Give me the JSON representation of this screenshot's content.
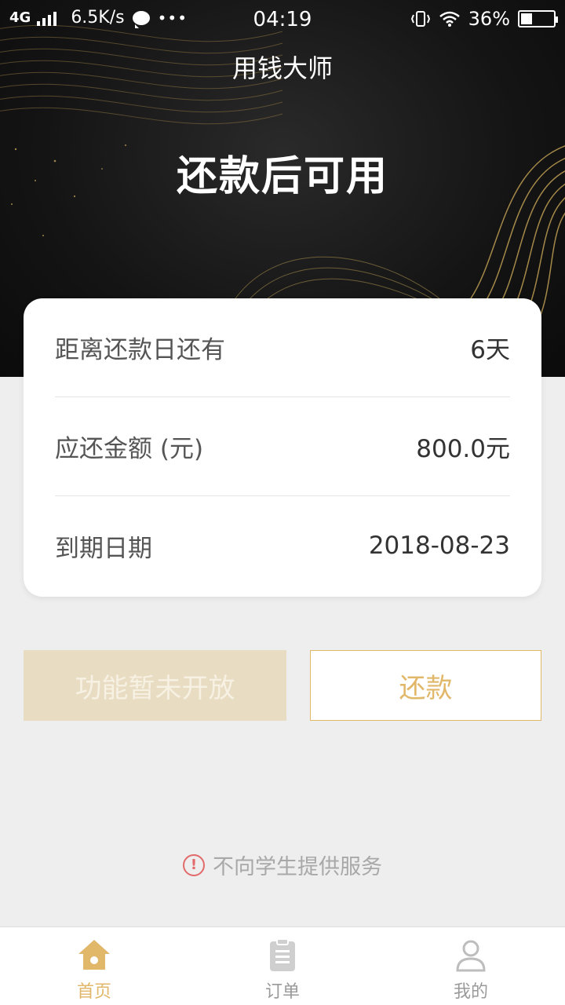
{
  "status_bar": {
    "network": "4G",
    "speed": "6.5K/s",
    "more": "•••",
    "time": "04:19",
    "battery_percent": "36%",
    "battery_level": 0.36
  },
  "header": {
    "title": "用钱大师",
    "status_text": "还款后可用"
  },
  "repayment_card": {
    "rows": [
      {
        "label": "距离还款日还有",
        "value": "6天"
      },
      {
        "label": "应还金额 (元)",
        "value": "800.0元"
      },
      {
        "label": "到期日期",
        "value": "2018-08-23"
      }
    ]
  },
  "actions": {
    "disabled_label": "功能暂未开放",
    "repay_label": "还款"
  },
  "notice": {
    "icon": "exclamation-icon",
    "text": "不向学生提供服务"
  },
  "tabbar": {
    "items": [
      {
        "label": "首页",
        "icon": "home-icon",
        "active": true
      },
      {
        "label": "订单",
        "icon": "clipboard-icon",
        "active": false
      },
      {
        "label": "我的",
        "icon": "user-icon",
        "active": false
      }
    ]
  },
  "colors": {
    "accent": "#e1b76a",
    "disabled_bg": "#e8dcc2",
    "hero_bg": "#141414",
    "page_bg": "#eeeeee"
  }
}
